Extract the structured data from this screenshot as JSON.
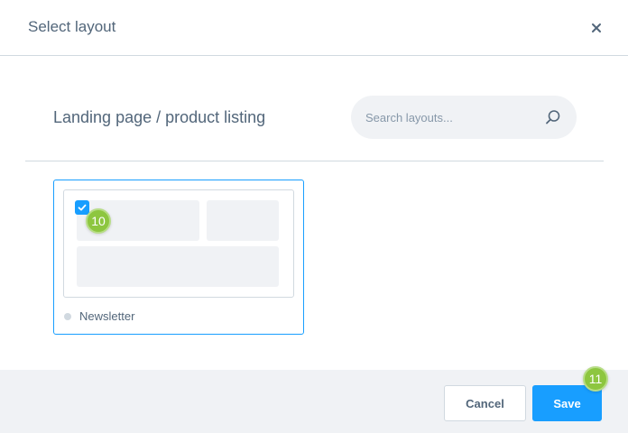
{
  "header": {
    "title": "Select layout"
  },
  "subheader": {
    "title": "Landing page / product listing"
  },
  "search": {
    "placeholder": "Search layouts...",
    "value": ""
  },
  "layouts": [
    {
      "label": "Newsletter",
      "selected": true
    }
  ],
  "annotations": {
    "badge_card": "10",
    "badge_save": "11"
  },
  "footer": {
    "cancel_label": "Cancel",
    "save_label": "Save"
  },
  "colors": {
    "accent": "#189eff",
    "badge": "#8dc63f",
    "text": "#52667a",
    "border": "#d1d9e0",
    "footer_bg": "#f0f2f5"
  }
}
